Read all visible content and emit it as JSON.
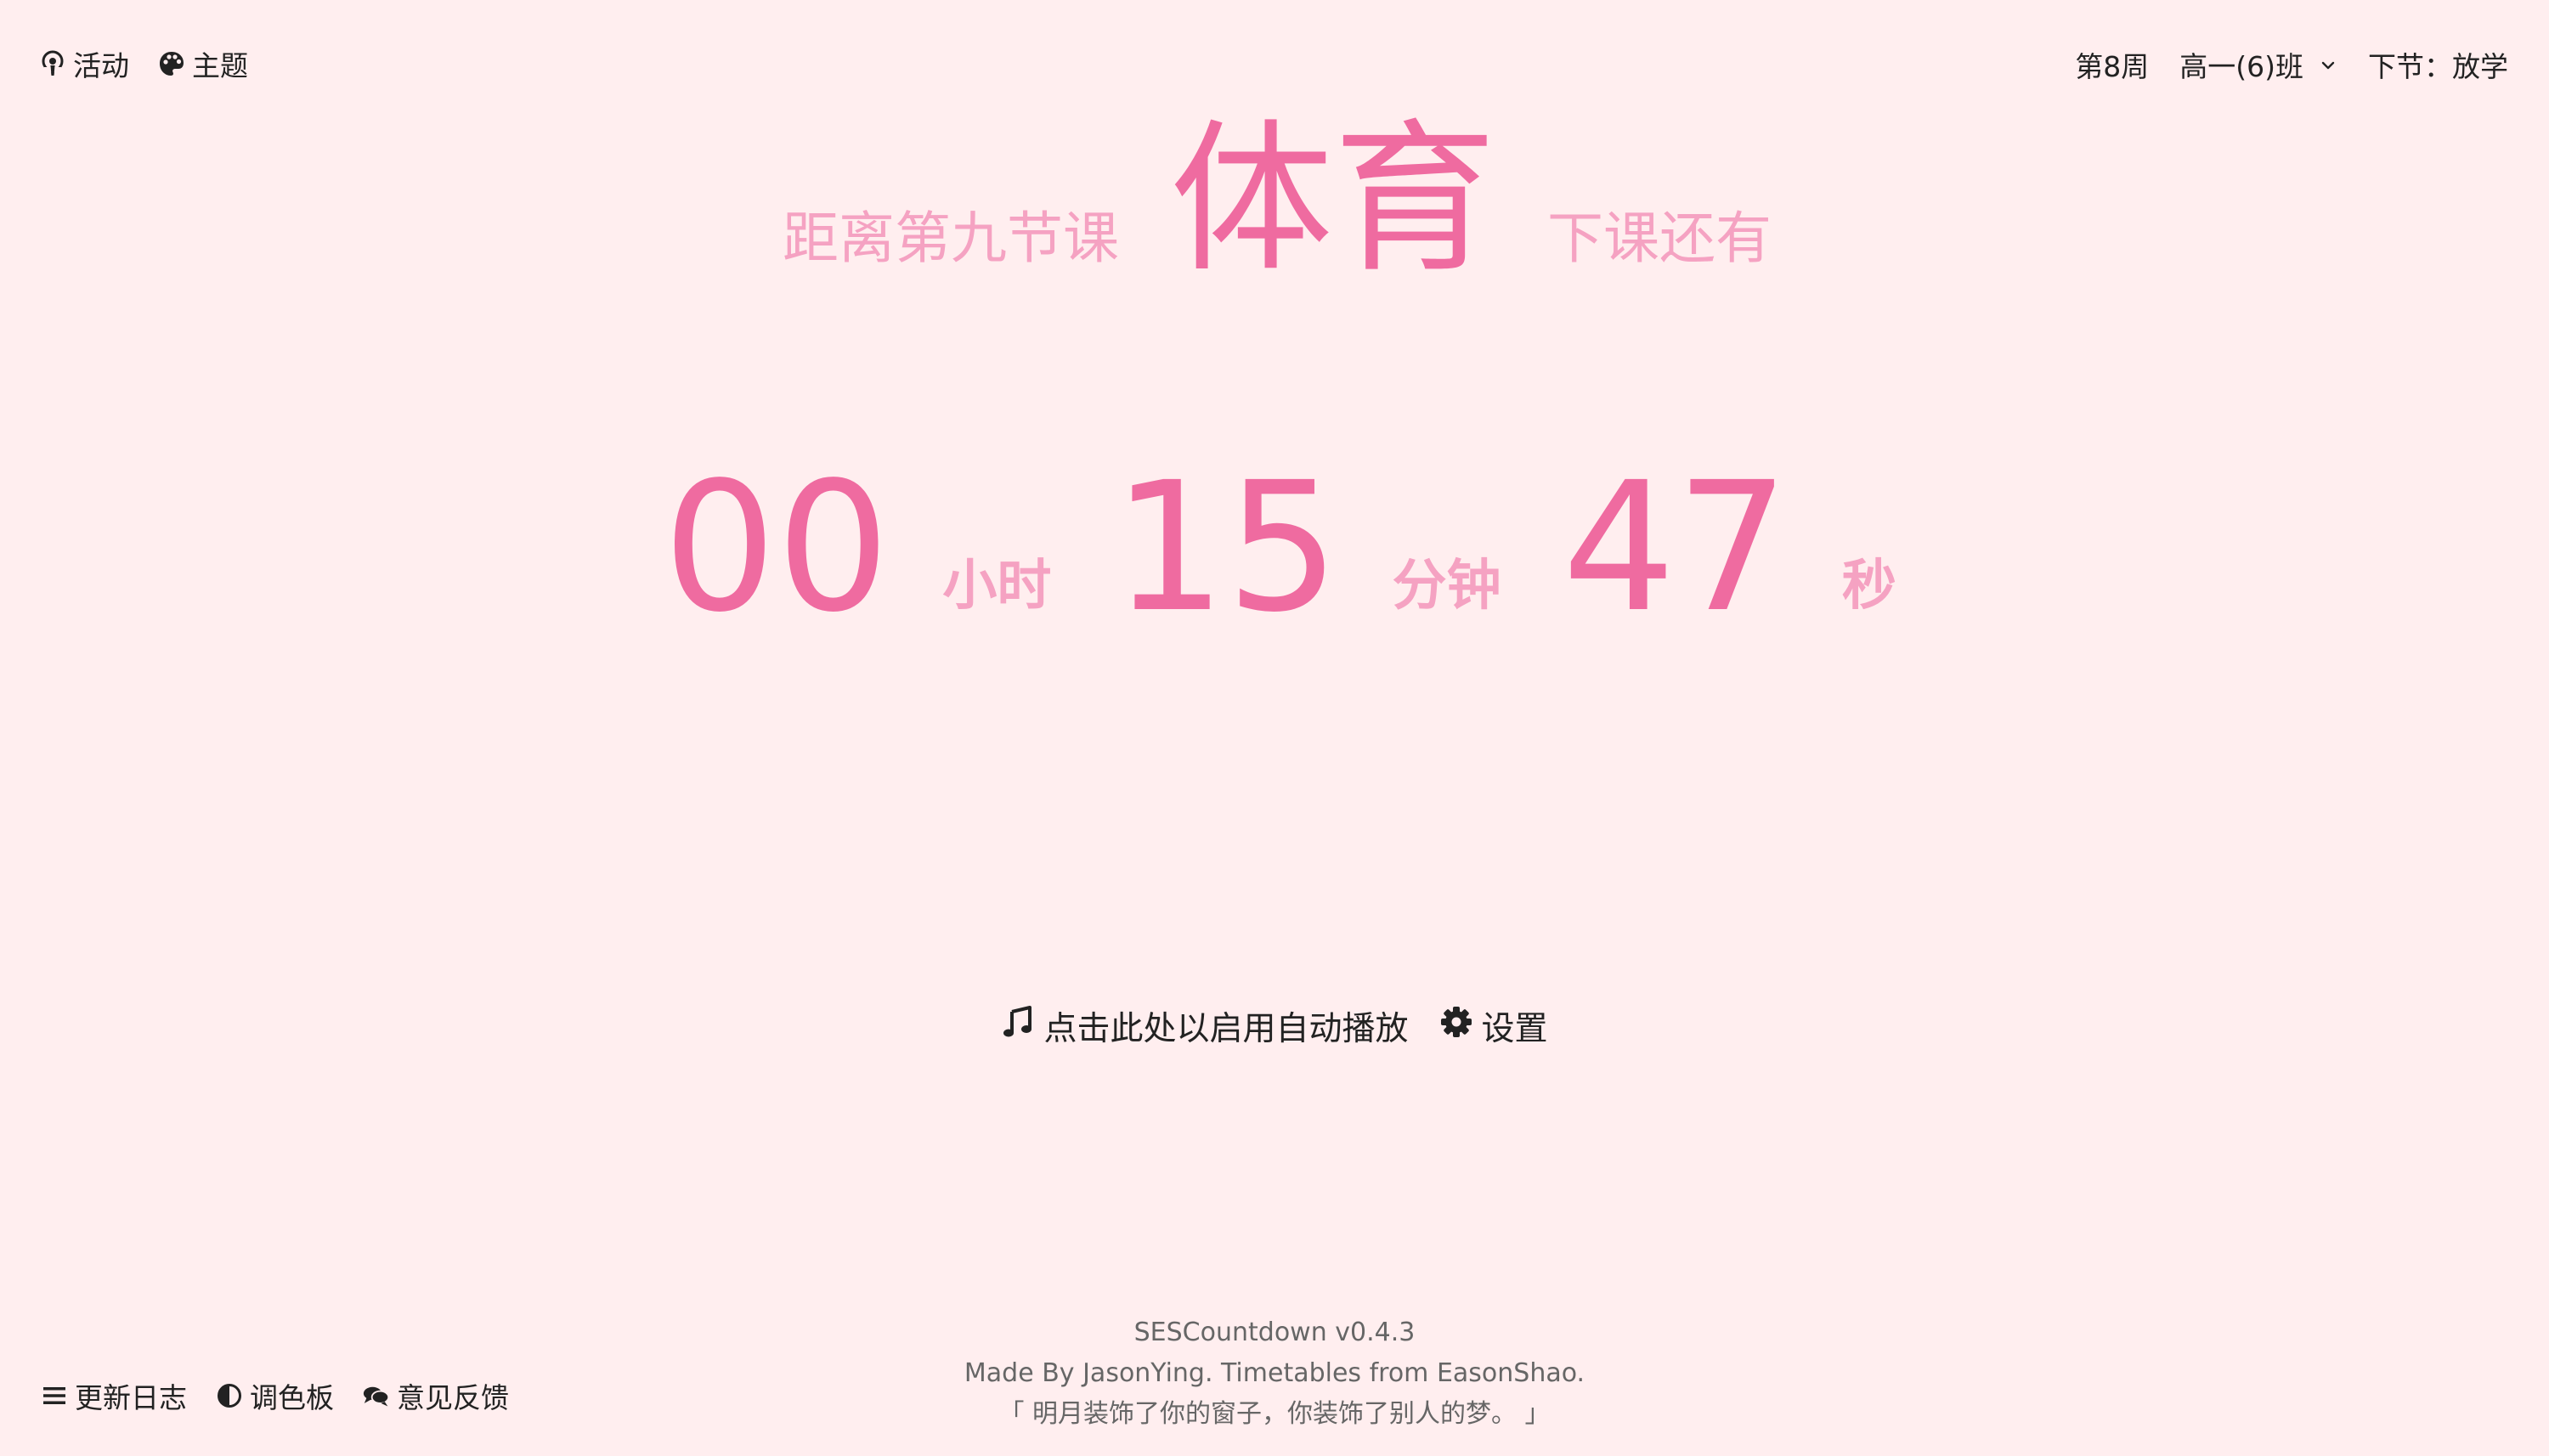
{
  "nav": {
    "activity_label": "活动",
    "theme_label": "主题",
    "week_label": "第8周",
    "class_select_value": "高一(6)班",
    "next_label": "下节：放学"
  },
  "headline": {
    "prefix": "距离第九节课",
    "subject": "体育",
    "suffix": "下课还有"
  },
  "countdown": {
    "hours": "00",
    "hours_unit": "小时",
    "minutes": "15",
    "minutes_unit": "分钟",
    "seconds": "47",
    "seconds_unit": "秒"
  },
  "actions": {
    "autoplay_label": "点击此处以启用自动播放",
    "settings_label": "设置"
  },
  "footer": {
    "changelog_label": "更新日志",
    "palette_label": "调色板",
    "feedback_label": "意见反馈",
    "version": "SESCountdown v0.4.3",
    "credits": "Made By JasonYing. Timetables from EasonShao.",
    "quote": "「 明月装饰了你的窗子，你装饰了别人的梦。 」"
  },
  "colors": {
    "background": "#ffeeef",
    "accent": "#ef6ba0",
    "accent_light": "#f5a2c2",
    "text": "#222222",
    "muted": "#666666"
  },
  "icons": {
    "activity": "podcast-icon",
    "theme": "palette-icon",
    "class_dropdown": "chevron-down-icon",
    "autoplay": "music-icon",
    "settings": "gear-icon",
    "changelog": "bars-icon",
    "palette": "half-circle-icon",
    "feedback": "comments-icon"
  }
}
